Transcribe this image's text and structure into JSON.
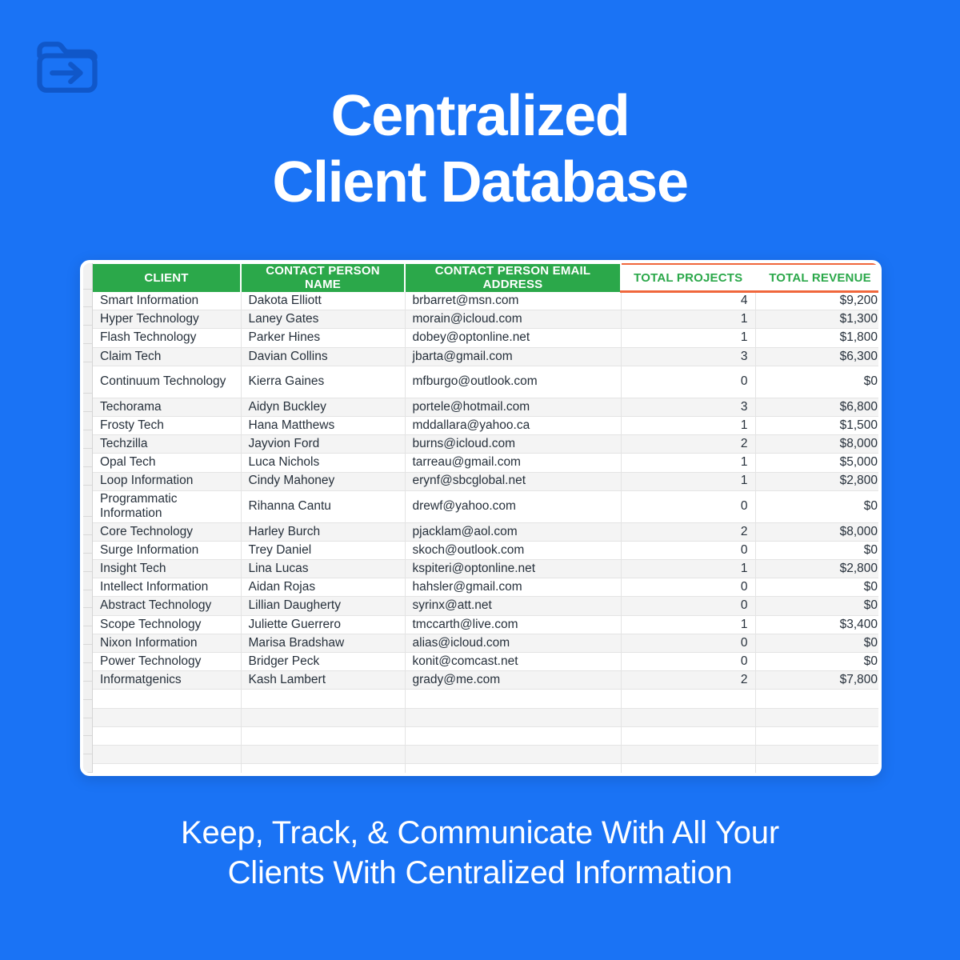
{
  "page": {
    "background_color": "#1a73f5",
    "accent_green": "#2ba84a",
    "accent_orange": "#f0673c"
  },
  "brand": {
    "icon": "folder-arrow-right-icon"
  },
  "headline": {
    "line1": "Centralized",
    "line2": "Client Database"
  },
  "caption": {
    "line1": "Keep, Track, & Communicate With All Your",
    "line2": "Clients With Centralized Information"
  },
  "table": {
    "headers": [
      "CLIENT",
      "CONTACT PERSON NAME",
      "CONTACT PERSON EMAIL ADDRESS",
      "TOTAL PROJECTS",
      "TOTAL REVENUE"
    ],
    "rows": [
      {
        "client": "Smart Information",
        "name": "Dakota Elliott",
        "email": "brbarret@msn.com",
        "projects": "4",
        "revenue": "$9,200"
      },
      {
        "client": "Hyper Technology",
        "name": "Laney Gates",
        "email": "morain@icloud.com",
        "projects": "1",
        "revenue": "$1,300"
      },
      {
        "client": "Flash Technology",
        "name": "Parker Hines",
        "email": "dobey@optonline.net",
        "projects": "1",
        "revenue": "$1,800"
      },
      {
        "client": "Claim Tech",
        "name": "Davian Collins",
        "email": "jbarta@gmail.com",
        "projects": "3",
        "revenue": "$6,300"
      },
      {
        "client": "Continuum Technology",
        "name": "Kierra Gaines",
        "email": "mfburgo@outlook.com",
        "projects": "0",
        "revenue": "$0",
        "tall": true
      },
      {
        "client": "Techorama",
        "name": "Aidyn Buckley",
        "email": "portele@hotmail.com",
        "projects": "3",
        "revenue": "$6,800"
      },
      {
        "client": "Frosty Tech",
        "name": "Hana Matthews",
        "email": "mddallara@yahoo.ca",
        "projects": "1",
        "revenue": "$1,500"
      },
      {
        "client": "Techzilla",
        "name": "Jayvion Ford",
        "email": "burns@icloud.com",
        "projects": "2",
        "revenue": "$8,000"
      },
      {
        "client": "Opal Tech",
        "name": "Luca Nichols",
        "email": "tarreau@gmail.com",
        "projects": "1",
        "revenue": "$5,000"
      },
      {
        "client": "Loop Information",
        "name": "Cindy Mahoney",
        "email": "erynf@sbcglobal.net",
        "projects": "1",
        "revenue": "$2,800"
      },
      {
        "client": "Programmatic Information",
        "name": "Rihanna Cantu",
        "email": "drewf@yahoo.com",
        "projects": "0",
        "revenue": "$0",
        "tall": true
      },
      {
        "client": "Core Technology",
        "name": "Harley Burch",
        "email": "pjacklam@aol.com",
        "projects": "2",
        "revenue": "$8,000"
      },
      {
        "client": "Surge Information",
        "name": "Trey Daniel",
        "email": "skoch@outlook.com",
        "projects": "0",
        "revenue": "$0"
      },
      {
        "client": "Insight Tech",
        "name": "Lina Lucas",
        "email": "kspiteri@optonline.net",
        "projects": "1",
        "revenue": "$2,800"
      },
      {
        "client": "Intellect Information",
        "name": "Aidan Rojas",
        "email": "hahsler@gmail.com",
        "projects": "0",
        "revenue": "$0"
      },
      {
        "client": "Abstract Technology",
        "name": "Lillian Daugherty",
        "email": "syrinx@att.net",
        "projects": "0",
        "revenue": "$0"
      },
      {
        "client": "Scope Technology",
        "name": "Juliette Guerrero",
        "email": "tmccarth@live.com",
        "projects": "1",
        "revenue": "$3,400"
      },
      {
        "client": "Nixon Information",
        "name": "Marisa Bradshaw",
        "email": "alias@icloud.com",
        "projects": "0",
        "revenue": "$0"
      },
      {
        "client": "Power Technology",
        "name": "Bridger Peck",
        "email": "konit@comcast.net",
        "projects": "0",
        "revenue": "$0"
      },
      {
        "client": "Informatgenics",
        "name": "Kash Lambert",
        "email": "grady@me.com",
        "projects": "2",
        "revenue": "$7,800"
      },
      {
        "client": "",
        "name": "",
        "email": "",
        "projects": "",
        "revenue": ""
      },
      {
        "client": "",
        "name": "",
        "email": "",
        "projects": "",
        "revenue": ""
      },
      {
        "client": "",
        "name": "",
        "email": "",
        "projects": "",
        "revenue": ""
      },
      {
        "client": "",
        "name": "",
        "email": "",
        "projects": "",
        "revenue": ""
      },
      {
        "client": "",
        "name": "",
        "email": "",
        "projects": "",
        "revenue": ""
      }
    ]
  }
}
